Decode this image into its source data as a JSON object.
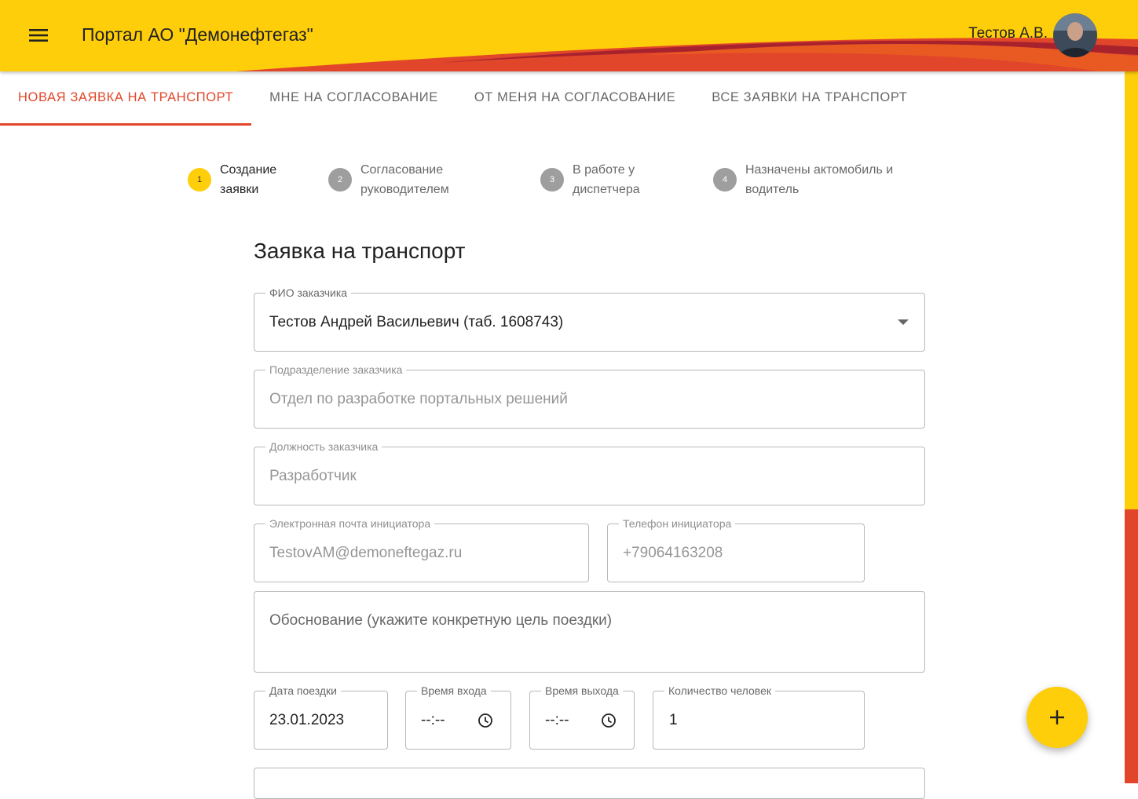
{
  "header": {
    "title": "Портал АО \"Демонефтегаз\"",
    "user_name": "Тестов А.В.",
    "menu_icon": "menu-icon",
    "avatar_icon": "user-avatar",
    "colors": {
      "brand_yellow": "#FFCE0A",
      "brand_red": "#E2462A",
      "brand_dark_red": "#A8222E"
    }
  },
  "tabs": [
    {
      "label": "Новая заявка на транспорт",
      "active": true
    },
    {
      "label": "Мне на согласование",
      "active": false
    },
    {
      "label": "От меня на согласование",
      "active": false
    },
    {
      "label": "Все заявки на транспорт",
      "active": false
    }
  ],
  "stepper": [
    {
      "number": "1",
      "label": "Создание\nзаявки",
      "active": true
    },
    {
      "number": "2",
      "label": "Согласование\nруководителем",
      "active": false
    },
    {
      "number": "3",
      "label": "В работе у\nдиспетчера",
      "active": false
    },
    {
      "number": "4",
      "label": "Назначены актомобиль и\nводитель",
      "active": false
    }
  ],
  "form": {
    "title": "Заявка на транспорт",
    "customer_name": {
      "label": "ФИО заказчика",
      "value": "Тестов Андрей Васильевич (таб. 1608743)"
    },
    "department": {
      "label": "Подразделение заказчика",
      "value": "Отдел по разработке портальных решений"
    },
    "position": {
      "label": "Должность заказчика",
      "value": "Разработчик"
    },
    "email": {
      "label": "Электронная почта инициатора",
      "value": "TestovAM@demoneftegaz.ru"
    },
    "phone": {
      "label": "Телефон инициатора",
      "value": "+79064163208"
    },
    "reason": {
      "placeholder": "Обоснование (укажите конкретную цель поездки)"
    },
    "trip_date": {
      "label": "Дата поездки",
      "value": "23.01.2023"
    },
    "entry_time": {
      "label": "Время входа",
      "value": "--:--"
    },
    "exit_time": {
      "label": "Время выхода",
      "value": "--:--"
    },
    "people_count": {
      "label": "Количество человек",
      "value": "1"
    }
  },
  "fab": {
    "icon": "plus-icon",
    "symbol": "+"
  }
}
